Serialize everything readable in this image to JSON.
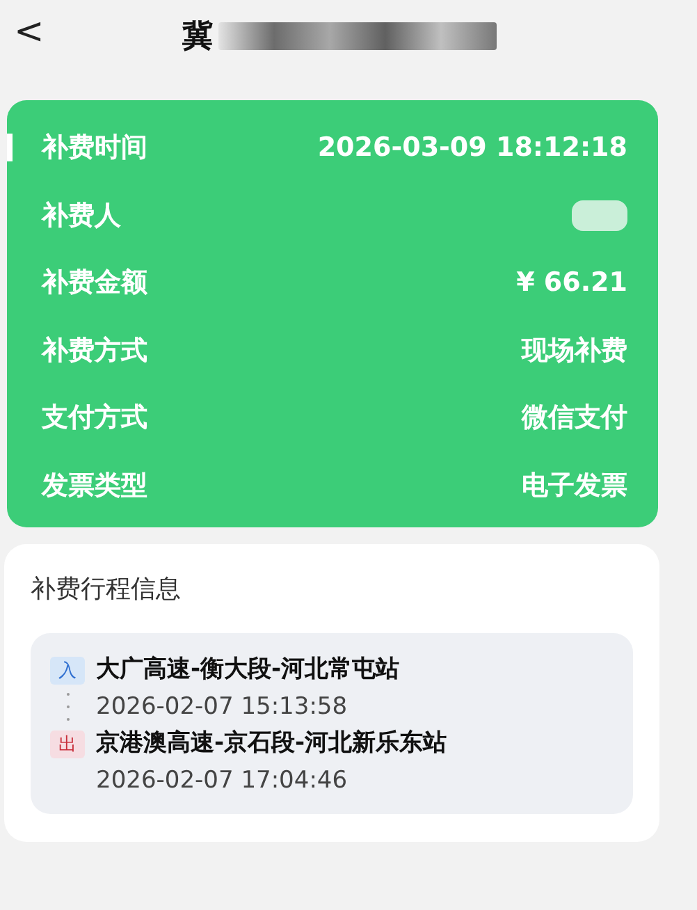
{
  "header": {
    "back_icon": "<",
    "title": "冀"
  },
  "payment": {
    "rows": [
      {
        "kind": "text",
        "label": "补费时间",
        "value": "2026-03-09 18:12:18",
        "selected": true
      },
      {
        "kind": "blurred",
        "label": "补费人",
        "selected": false
      },
      {
        "kind": "text",
        "label": "补费金额",
        "value": "¥ 66.21",
        "selected": false
      },
      {
        "kind": "text",
        "label": "补费方式",
        "value": "现场补费",
        "selected": false
      },
      {
        "kind": "text",
        "label": "支付方式",
        "value": "微信支付",
        "selected": false
      },
      {
        "kind": "text",
        "label": "发票类型",
        "value": "电子发票",
        "selected": false
      }
    ]
  },
  "trip": {
    "title": "补费行程信息",
    "stops": [
      {
        "kind": "entry",
        "tag": "入",
        "station": "大广高速-衡大段-河北常屯站",
        "time": "2026-02-07 15:13:58"
      },
      {
        "kind": "exit",
        "tag": "出",
        "station": "京港澳高速-京石段-河北新乐东站",
        "time": "2026-02-07 17:04:46"
      }
    ]
  }
}
